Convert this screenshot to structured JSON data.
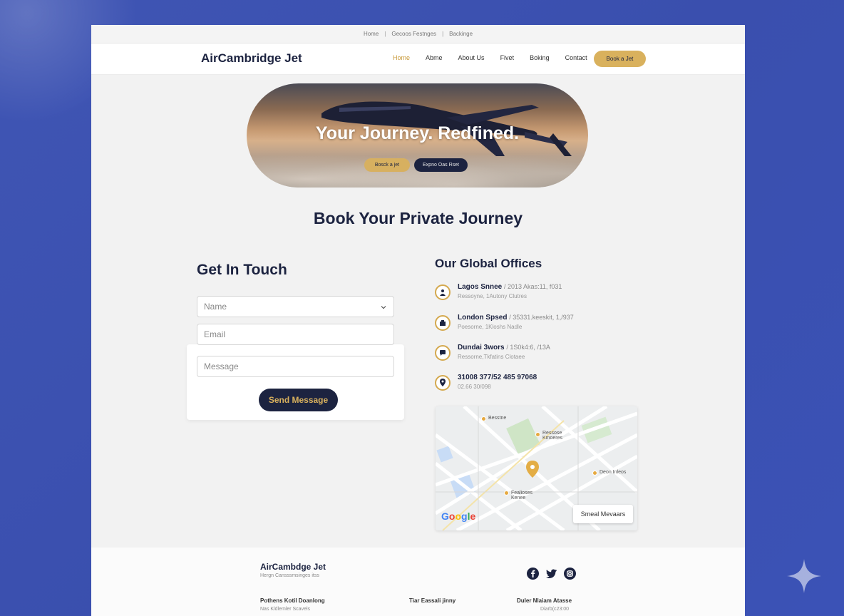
{
  "utility_bar": {
    "items": [
      "Home",
      "Gecoos Festnges",
      "Backinge"
    ],
    "separators": [
      "|",
      "|"
    ]
  },
  "nav": {
    "brand": "AirCambridge Jet",
    "links": [
      {
        "label": "Home",
        "active": true
      },
      {
        "label": "Abme",
        "active": false
      },
      {
        "label": "About Us",
        "active": false
      },
      {
        "label": "Fivet",
        "active": false
      },
      {
        "label": "Boking",
        "active": false
      },
      {
        "label": "Contact",
        "active": false
      }
    ],
    "cta": "Book a Jet"
  },
  "hero": {
    "title": "Your Journey. Redfined.",
    "primary_button": "Bosck a jet",
    "secondary_button": "Expno Oas Rset"
  },
  "section_title": "Book Your Private Journey",
  "contact": {
    "title": "Get In Touch",
    "name_placeholder": "Name",
    "email_placeholder": "Email",
    "message_placeholder": "Message",
    "send_button": "Send Message"
  },
  "offices": {
    "title": "Our Global Offices",
    "items": [
      {
        "name": "Lagos Snnee",
        "detail": "/ 2013 Akas:11, f031",
        "sub": "Ressoyne, 1Autony Clutres",
        "icon": "person-icon"
      },
      {
        "name": "London Spsed",
        "detail": "/ 35331.keeskit, 1,/937",
        "sub": "Poesorne, 1Kloshs Nadle",
        "icon": "building-icon"
      },
      {
        "name": "Dundai 3wors",
        "detail": "/ 1S0k4:6, /13A",
        "sub": "Ressorne,Tkfatins Clotaee",
        "icon": "chat-icon"
      },
      {
        "name": "31008 377/52 485 97068",
        "detail": "",
        "sub": "02.66 30/098",
        "icon": "location-pin-icon"
      }
    ]
  },
  "map": {
    "labels": [
      "Besstne",
      "Ressose Kmoeres",
      "Deon Inleos",
      "Fealioses Kenee"
    ],
    "brand": [
      "G",
      "o",
      "o",
      "g",
      "l",
      "e"
    ],
    "button": "Smeal Mevaars"
  },
  "footer": {
    "brand": "AirCambdge Jet",
    "tagline": "Hergn Cansssmsinges itss",
    "columns": [
      {
        "title": "Pothens Kotil Doanlong",
        "sub": "Nas Kldlemler Scavels"
      },
      {
        "title": "Tiar Eassali jinny",
        "sub": ""
      },
      {
        "title": "Duler Nlaiam Atasse",
        "sub": "Diarb(c23:00"
      }
    ],
    "social_icons": [
      "facebook-icon",
      "twitter-icon",
      "instagram-icon"
    ]
  },
  "colors": {
    "navy": "#1c2340",
    "gold": "#d9b15d",
    "background": "#3f55b4"
  }
}
